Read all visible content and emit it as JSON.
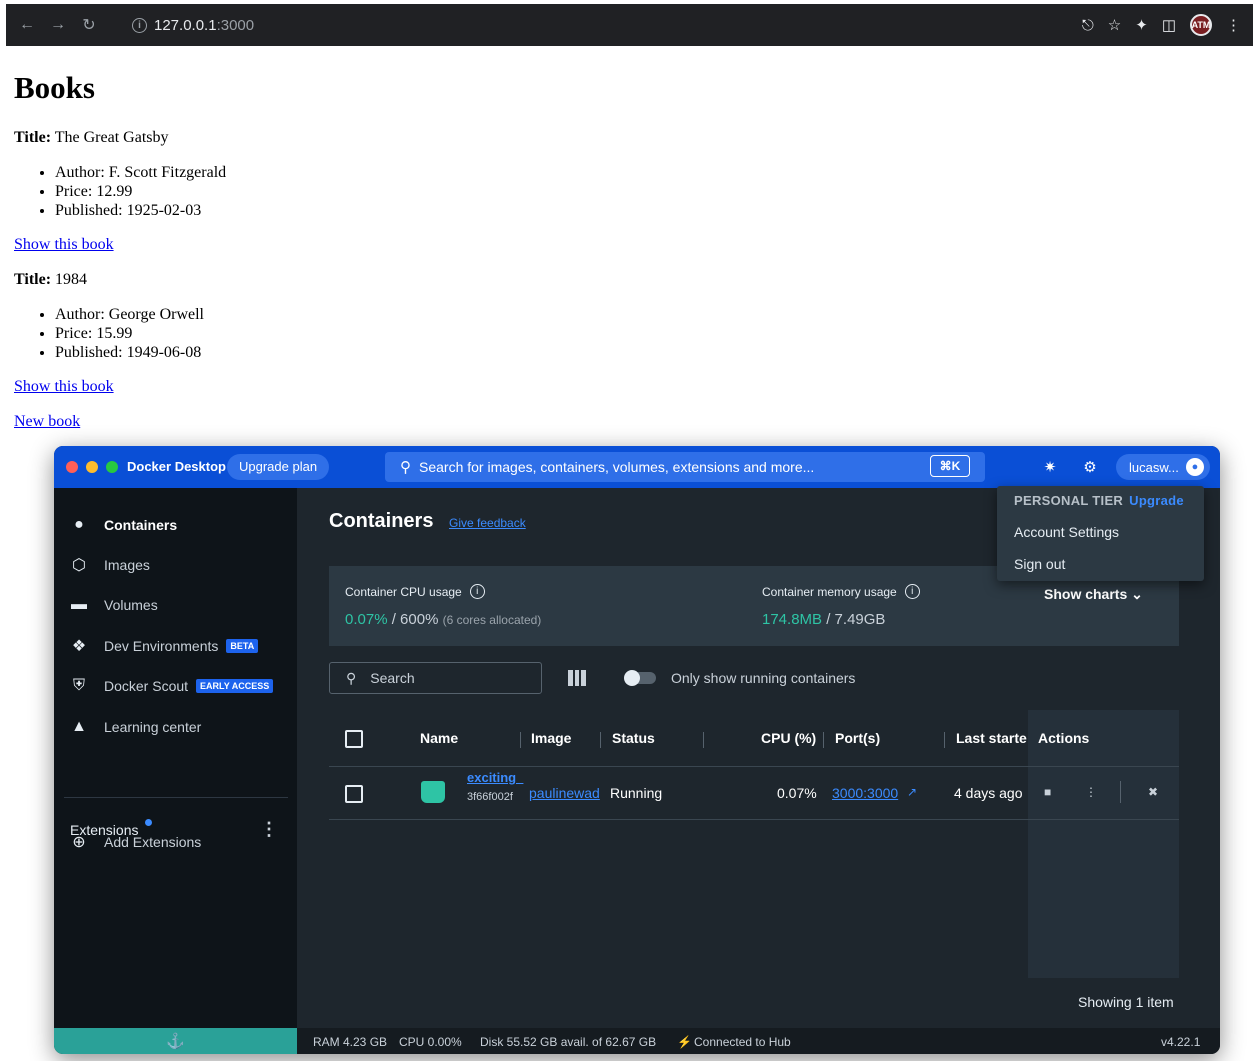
{
  "browser": {
    "url_host": "127.0.0.1",
    "url_port": ":3000"
  },
  "page": {
    "heading": "Books",
    "title_label": "Title:",
    "books": [
      {
        "title": "The Great Gatsby",
        "author": "Author: F. Scott Fitzgerald",
        "price": "Price: 12.99",
        "published": "Published: 1925-02-03",
        "link": "Show this book"
      },
      {
        "title": "1984",
        "author": "Author: George Orwell",
        "price": "Price: 15.99",
        "published": "Published: 1949-06-08",
        "link": "Show this book"
      }
    ],
    "new_book_link": "New book"
  },
  "docker": {
    "app_name": "Docker Desktop",
    "upgrade_plan": "Upgrade plan",
    "search_placeholder": "Search for images, containers, volumes, extensions and more...",
    "search_shortcut": "⌘K",
    "user": "lucasw...",
    "sidebar": {
      "items": [
        {
          "label": "Containers",
          "icon": "container-icon"
        },
        {
          "label": "Images",
          "icon": "image-icon"
        },
        {
          "label": "Volumes",
          "icon": "volume-icon"
        },
        {
          "label": "Dev Environments",
          "icon": "dev-env-icon",
          "badge": "BETA"
        },
        {
          "label": "Docker Scout",
          "icon": "shield-icon",
          "badge": "EARLY ACCESS"
        },
        {
          "label": "Learning center",
          "icon": "graduation-cap-icon"
        }
      ],
      "extensions_label": "Extensions",
      "add_extensions": "Add Extensions"
    },
    "main": {
      "title": "Containers",
      "feedback": "Give feedback",
      "cpu_label": "Container CPU usage",
      "cpu_used": "0.07%",
      "cpu_total": "/ 600%",
      "cpu_note": "(6 cores allocated)",
      "mem_label": "Container memory usage",
      "mem_used": "174.8MB",
      "mem_total": "/ 7.49GB",
      "show_charts": "Show charts",
      "search_placeholder": "Search",
      "toggle_label": "Only show running containers",
      "columns": [
        "Name",
        "Image",
        "Status",
        "CPU (%)",
        "Port(s)",
        "Last starte",
        "Actions"
      ],
      "rows": [
        {
          "name": "exciting_",
          "id": "3f66f002f",
          "image": "paulinewad",
          "status": "Running",
          "cpu": "0.07%",
          "port": "3000:3000",
          "last_started": "4 days ago"
        }
      ],
      "showing": "Showing 1 item"
    },
    "menu": {
      "tier": "PERSONAL TIER",
      "upgrade": "Upgrade",
      "account_settings": "Account Settings",
      "sign_out": "Sign out"
    },
    "footer": {
      "ram": "RAM 4.23 GB",
      "cpu": "CPU 0.00%",
      "disk": "Disk 55.52 GB avail. of 62.67 GB",
      "hub": "Connected to Hub",
      "version": "v4.22.1"
    },
    "colors": {
      "accent": "#0a4fd6",
      "running": "#2ec4a5",
      "link": "#3b8bff"
    }
  }
}
